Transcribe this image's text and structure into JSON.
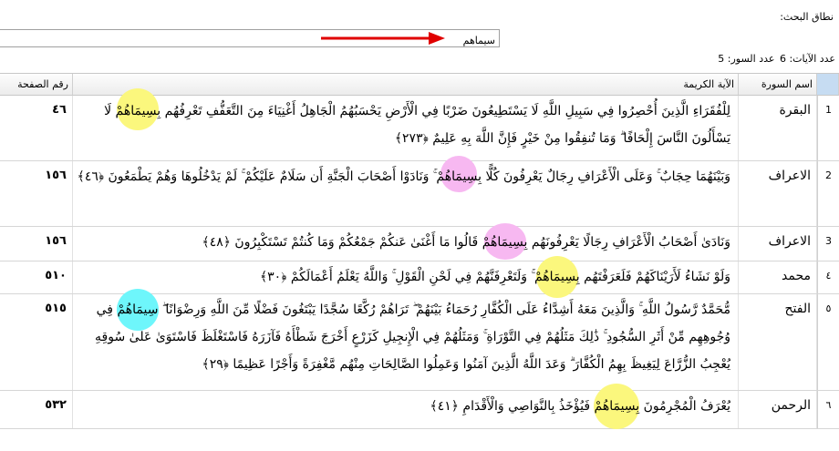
{
  "search": {
    "scope_label": "نطاق البحث:",
    "value": "سيماهم",
    "counts_text_ayat": "عدد الآيات:  6",
    "counts_text_suras": "عدد السور: 5"
  },
  "table": {
    "headers": {
      "num": "",
      "sura": "اسم السورة",
      "verse": "الآية الكريمة",
      "page": "رقم الصفحة"
    },
    "rows": [
      {
        "num": "1",
        "sura": "البقرة",
        "page": "٤٦",
        "before": "لِلْفُقَرَاءِ الَّذِينَ أُحْصِرُوا فِي سَبِيلِ اللَّهِ لَا يَسْتَطِيعُونَ ضَرْبًا فِي الْأَرْضِ يَحْسَبُهُمُ الْجَاهِلُ أَغْنِيَاءَ مِنَ التَّعَفُّفِ تَعْرِفُهُم ",
        "match": "بِسِيمَاهُمْ",
        "after": " لَا يَسْأَلُونَ النَّاسَ إِلْحَافًا ۗ وَمَا تُنفِقُوا مِنْ خَيْرٍ فَإِنَّ اللَّهَ بِهِ عَلِيمٌ ﴿٢٧٣﴾",
        "blob": "y"
      },
      {
        "num": "2",
        "sura": "الاعراف",
        "page": "١٥٦",
        "before": "وَبَيْنَهُمَا حِجَابٌ ۚ وَعَلَى الْأَعْرَافِ رِجَالٌ يَعْرِفُونَ كُلًّا ",
        "match": "بِسِيمَاهُمْ",
        "after": " ۚ وَنَادَوْا أَصْحَابَ الْجَنَّةِ أَن سَلَامٌ عَلَيْكُمْ ۚ لَمْ يَدْخُلُوهَا وَهُمْ يَطْمَعُونَ ﴿٤٦﴾",
        "blob": "p"
      },
      {
        "num": "3",
        "sura": "الاعراف",
        "page": "١٥٦",
        "before": "وَنَادَىٰ أَصْحَابُ الْأَعْرَافِ رِجَالًا يَعْرِفُونَهُم ",
        "match": "بِسِيمَاهُمْ",
        "after": " قَالُوا مَا أَغْنَىٰ عَنكُمْ جَمْعُكُمْ وَمَا كُنتُمْ تَسْتَكْبِرُونَ ﴿٤٨﴾",
        "blob": "p"
      },
      {
        "num": "٤",
        "sura": "محمد",
        "page": "٥١٠",
        "before": "وَلَوْ نَشَاءُ لَأَرَيْنَاكَهُمْ فَلَعَرَفْتَهُم ",
        "match": "بِسِيمَاهُمْ",
        "after": " ۚ وَلَتَعْرِفَنَّهُمْ فِي لَحْنِ الْقَوْلِ ۚ وَاللَّهُ يَعْلَمُ أَعْمَالَكُمْ ﴿٣٠﴾",
        "blob": "y"
      },
      {
        "num": "٥",
        "sura": "الفتح",
        "page": "٥١٥",
        "before": "مُّحَمَّدٌ رَّسُولُ اللَّهِ ۚ وَالَّذِينَ مَعَهُ أَشِدَّاءُ عَلَى الْكُفَّارِ رُحَمَاءُ بَيْنَهُمْ ۖ تَرَاهُمْ رُكَّعًا سُجَّدًا يَبْتَغُونَ فَضْلًا مِّنَ اللَّهِ وَرِضْوَانًا ۖ ",
        "match": "سِيمَاهُمْ",
        "after": " فِي وُجُوهِهِم مِّنْ أَثَرِ السُّجُودِ ۚ ذَٰلِكَ مَثَلُهُمْ فِي التَّوْرَاةِ ۚ وَمَثَلُهُمْ فِي الْإِنجِيلِ كَزَرْعٍ أَخْرَجَ شَطْأَهُ فَآزَرَهُ فَاسْتَغْلَظَ فَاسْتَوَىٰ عَلَىٰ سُوقِهِ يُعْجِبُ الزُّرَّاعَ لِيَغِيظَ بِهِمُ الْكُفَّارَ ۗ وَعَدَ اللَّهُ الَّذِينَ آمَنُوا وَعَمِلُوا الصَّالِحَاتِ مِنْهُم مَّغْفِرَةً وَأَجْرًا عَظِيمًا ﴿٢٩﴾",
        "blob": "c"
      },
      {
        "num": "٦",
        "sura": "الرحمن",
        "page": "٥٣٢",
        "before": "يُعْرَفُ الْمُجْرِمُونَ ",
        "match": "بِسِيمَاهُمْ",
        "after": " فَيُؤْخَذُ بِالنَّوَاصِي وَالْأَقْدَامِ ﴿٤١﴾",
        "blob": "y"
      }
    ]
  },
  "colors": {
    "yellow": "#fbf77d",
    "pink": "#f7b8f1",
    "cyan": "#6ef6fb",
    "arrow": "#e00000"
  }
}
